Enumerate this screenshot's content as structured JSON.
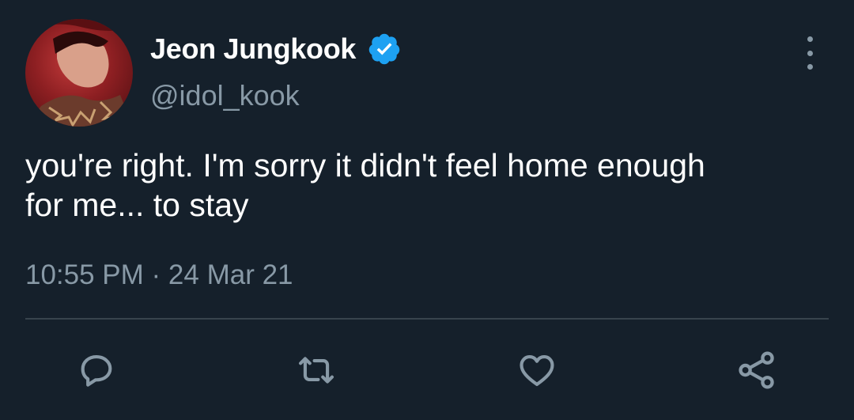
{
  "tweet": {
    "author": {
      "display_name": "Jeon Jungkook",
      "handle": "@idol_kook",
      "verified": true
    },
    "text": "you're right. I'm sorry it didn't feel home enough\nfor me... to stay",
    "time": "10:55 PM",
    "separator": " · ",
    "date": "24 Mar 21"
  },
  "actions": {
    "reply_icon": "speech-bubble",
    "retweet_icon": "retweet-arrows",
    "like_icon": "heart-outline",
    "share_icon": "share-nodes"
  },
  "colors": {
    "background": "#15202b",
    "text_primary": "#ffffff",
    "text_secondary": "#8899a6",
    "verified_badge": "#1da1f2",
    "divider": "#38444d"
  }
}
